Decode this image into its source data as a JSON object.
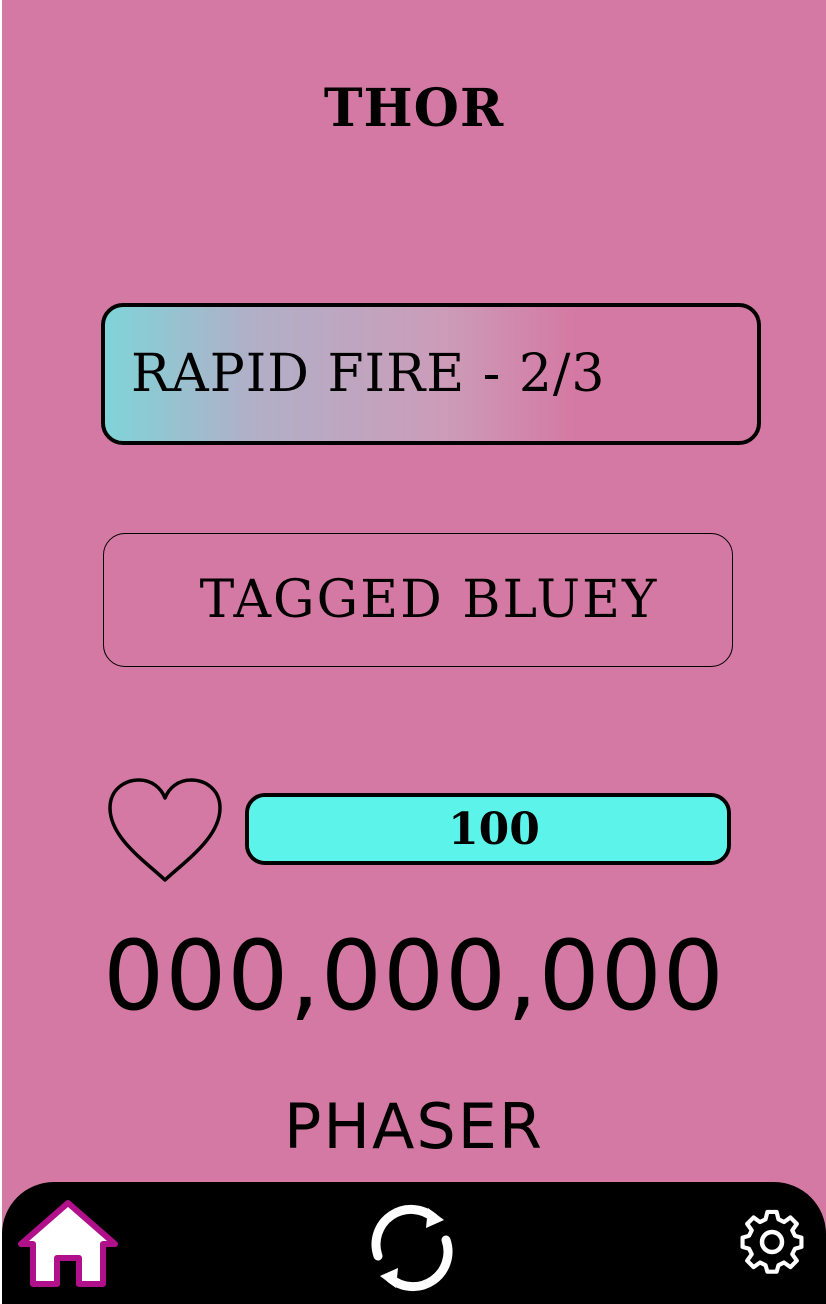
{
  "player": {
    "name": "THOR"
  },
  "ability": {
    "label": "RAPID FIRE - 2/3"
  },
  "status": {
    "message": "TAGGED BLUEY"
  },
  "health": {
    "value": "100",
    "fill_fraction": 1.0,
    "icon": "heart-icon"
  },
  "score": {
    "value": "000,000,000"
  },
  "weapon": {
    "name": "PHASER"
  },
  "nav": {
    "home_icon": "home-icon",
    "refresh_icon": "refresh-icon",
    "settings_icon": "gear-icon"
  },
  "colors": {
    "background": "#d479a3",
    "health_fill": "#5cf4ea",
    "ability_gradient_start": "#7fd4d8",
    "nav_bar": "#000000",
    "home_icon_stroke": "#b0108a"
  }
}
